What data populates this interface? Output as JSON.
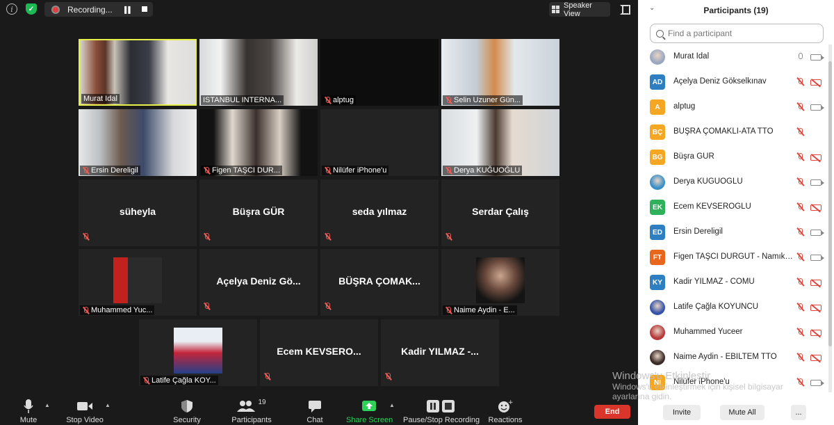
{
  "topbar": {
    "recording_label": "Recording...",
    "speaker_view_label": "Speaker View"
  },
  "tiles": [
    {
      "name": "Murat Idal",
      "type": "video",
      "muted": false,
      "active": true
    },
    {
      "name": "ISTANBUL INTERNA...",
      "type": "video",
      "muted": false,
      "active": false
    },
    {
      "name": "alptug",
      "type": "video",
      "muted": true,
      "active": false
    },
    {
      "name": "Selin Uzuner Gün...",
      "type": "video",
      "muted": true,
      "active": false
    },
    {
      "name": "Ersin Dereligil",
      "type": "video",
      "muted": true,
      "active": false
    },
    {
      "name": "Figen TAŞCI DUR...",
      "type": "video",
      "muted": true,
      "active": false
    },
    {
      "name": "Nilüfer iPhone'u",
      "type": "video",
      "muted": true,
      "active": false
    },
    {
      "name": "Derya KUĞUOĞLU",
      "type": "video",
      "muted": true,
      "active": false
    },
    {
      "name": "süheyla",
      "type": "name",
      "muted": true
    },
    {
      "name": "Büşra GÜR",
      "type": "name",
      "muted": true
    },
    {
      "name": "seda yılmaz",
      "type": "name",
      "muted": true
    },
    {
      "name": "Serdar Çalış",
      "type": "name",
      "muted": true
    },
    {
      "name": "Muhammed Yuc...",
      "type": "avatar",
      "muted": true
    },
    {
      "name": "Açelya Deniz Gö...",
      "type": "name",
      "muted": true
    },
    {
      "name": "BÜŞRA ÇOMAK...",
      "type": "name",
      "muted": true
    },
    {
      "name": "Naime Aydin - E...",
      "type": "avatar",
      "muted": true
    },
    {
      "name": "Latife Çağla KOY...",
      "type": "avatar",
      "muted": true
    },
    {
      "name": "Ecem KEVSERO...",
      "type": "name",
      "muted": true
    },
    {
      "name": "Kadir YILMAZ -...",
      "type": "name",
      "muted": true
    }
  ],
  "toolbar": {
    "mute": "Mute",
    "stop_video": "Stop Video",
    "security": "Security",
    "participants": "Participants",
    "participants_count": "19",
    "chat": "Chat",
    "share_screen": "Share Screen",
    "pause_stop_recording": "Pause/Stop Recording",
    "reactions": "Reactions",
    "end": "End"
  },
  "panel": {
    "title": "Participants (19)",
    "search_placeholder": "Find a participant",
    "participants": [
      {
        "initials": "",
        "name": "Murat Idal",
        "color": "#9aa7c0",
        "photo": true,
        "mic": "on",
        "cam": "on"
      },
      {
        "initials": "AD",
        "name": "Açelya Deniz Gökselkınav",
        "color": "#2d7fc1",
        "photo": false,
        "mic": "off",
        "cam": "off"
      },
      {
        "initials": "A",
        "name": "alptug",
        "color": "#f5a623",
        "photo": false,
        "mic": "off",
        "cam": "on"
      },
      {
        "initials": "BÇ",
        "name": "BÜŞRA ÇOMAKLI-ATA TTO",
        "color": "#f5a623",
        "photo": false,
        "mic": "off",
        "cam": "none"
      },
      {
        "initials": "BG",
        "name": "Büşra GÜR",
        "color": "#f5a623",
        "photo": false,
        "mic": "off",
        "cam": "off"
      },
      {
        "initials": "",
        "name": "Derya KUĞUOĞLU",
        "color": "#3a8fc8",
        "photo": true,
        "mic": "off",
        "cam": "on"
      },
      {
        "initials": "EK",
        "name": "Ecem KEVSEROĞLU",
        "color": "#2fb05a",
        "photo": false,
        "mic": "off",
        "cam": "off"
      },
      {
        "initials": "ED",
        "name": "Ersin Dereligil",
        "color": "#2d7fc1",
        "photo": false,
        "mic": "off",
        "cam": "on"
      },
      {
        "initials": "FT",
        "name": "Figen TAŞCI DURGUT - Namık K...",
        "color": "#e8671d",
        "photo": false,
        "mic": "off",
        "cam": "on"
      },
      {
        "initials": "KY",
        "name": "Kadir YILMAZ - COMU",
        "color": "#2d7fc1",
        "photo": false,
        "mic": "off",
        "cam": "off"
      },
      {
        "initials": "",
        "name": "Latife Çağla KOYUNCU",
        "color": "#3553a8",
        "photo": true,
        "mic": "off",
        "cam": "off"
      },
      {
        "initials": "",
        "name": "Muhammed Yuceer",
        "color": "#b53a3a",
        "photo": true,
        "mic": "off",
        "cam": "off"
      },
      {
        "initials": "",
        "name": "Naime Aydin - EBILTEM TTO",
        "color": "#3a2a25",
        "photo": true,
        "mic": "off",
        "cam": "off"
      },
      {
        "initials": "NI",
        "name": "Nilüfer iPhone'u",
        "color": "#f5a623",
        "photo": false,
        "mic": "off",
        "cam": "on"
      }
    ],
    "invite": "Invite",
    "mute_all": "Mute All",
    "more": "..."
  },
  "watermark": {
    "line1": "Windows'u Etkinleştir",
    "line2": "Windows'u etkinleştirmek için kişisel bilgisayar",
    "line3": "ayarlarına gidin."
  }
}
